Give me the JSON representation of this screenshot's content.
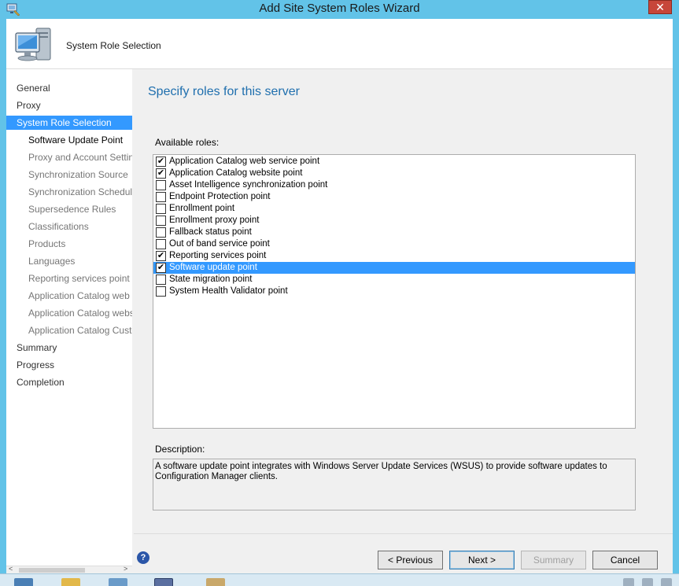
{
  "window": {
    "title": "Add Site System Roles Wizard",
    "close_glyph": "✕"
  },
  "header": {
    "title": "System Role Selection",
    "icon": "computer-icon"
  },
  "nav": {
    "items": [
      {
        "label": "General",
        "level": "top",
        "state": "normal"
      },
      {
        "label": "Proxy",
        "level": "top",
        "state": "normal"
      },
      {
        "label": "System Role Selection",
        "level": "top",
        "state": "selected"
      },
      {
        "label": "Software Update Point",
        "level": "sub",
        "state": "current"
      },
      {
        "label": "Proxy and Account Settings",
        "level": "sub",
        "state": "normal"
      },
      {
        "label": "Synchronization Source",
        "level": "sub",
        "state": "normal"
      },
      {
        "label": "Synchronization Schedule",
        "level": "sub",
        "state": "normal"
      },
      {
        "label": "Supersedence Rules",
        "level": "sub",
        "state": "normal"
      },
      {
        "label": "Classifications",
        "level": "sub",
        "state": "normal"
      },
      {
        "label": "Products",
        "level": "sub",
        "state": "normal"
      },
      {
        "label": "Languages",
        "level": "sub",
        "state": "normal"
      },
      {
        "label": "Reporting services point",
        "level": "sub",
        "state": "normal"
      },
      {
        "label": "Application Catalog web",
        "level": "sub",
        "state": "normal"
      },
      {
        "label": "Application Catalog website",
        "level": "sub",
        "state": "normal"
      },
      {
        "label": "Application Catalog Customizations",
        "level": "sub",
        "state": "normal"
      },
      {
        "label": "Summary",
        "level": "top",
        "state": "normal"
      },
      {
        "label": "Progress",
        "level": "top",
        "state": "normal"
      },
      {
        "label": "Completion",
        "level": "top",
        "state": "normal"
      }
    ]
  },
  "main": {
    "heading": "Specify roles for this server",
    "available_roles_label": "Available roles:",
    "check_glyph": "✔",
    "roles": [
      {
        "label": "Application Catalog web service point",
        "checked": true,
        "selected": false
      },
      {
        "label": "Application Catalog website point",
        "checked": true,
        "selected": false
      },
      {
        "label": "Asset Intelligence synchronization point",
        "checked": false,
        "selected": false
      },
      {
        "label": "Endpoint Protection point",
        "checked": false,
        "selected": false
      },
      {
        "label": "Enrollment point",
        "checked": false,
        "selected": false
      },
      {
        "label": "Enrollment proxy point",
        "checked": false,
        "selected": false
      },
      {
        "label": "Fallback status point",
        "checked": false,
        "selected": false
      },
      {
        "label": "Out of band service point",
        "checked": false,
        "selected": false
      },
      {
        "label": "Reporting services point",
        "checked": true,
        "selected": false
      },
      {
        "label": "Software update point",
        "checked": true,
        "selected": true
      },
      {
        "label": "State migration point",
        "checked": false,
        "selected": false
      },
      {
        "label": "System Health Validator point",
        "checked": false,
        "selected": false
      }
    ],
    "description_label": "Description:",
    "description_text": "A software update point integrates with Windows Server Update Services (WSUS) to provide software updates to Configuration Manager clients."
  },
  "footer": {
    "help_glyph": "?",
    "previous_label": "< Previous",
    "next_label": "Next >",
    "summary_label": "Summary",
    "cancel_label": "Cancel",
    "summary_enabled": false
  },
  "colors": {
    "selection": "#3399ff",
    "titlebar": "#62c3e8",
    "heading": "#1f6fae"
  }
}
